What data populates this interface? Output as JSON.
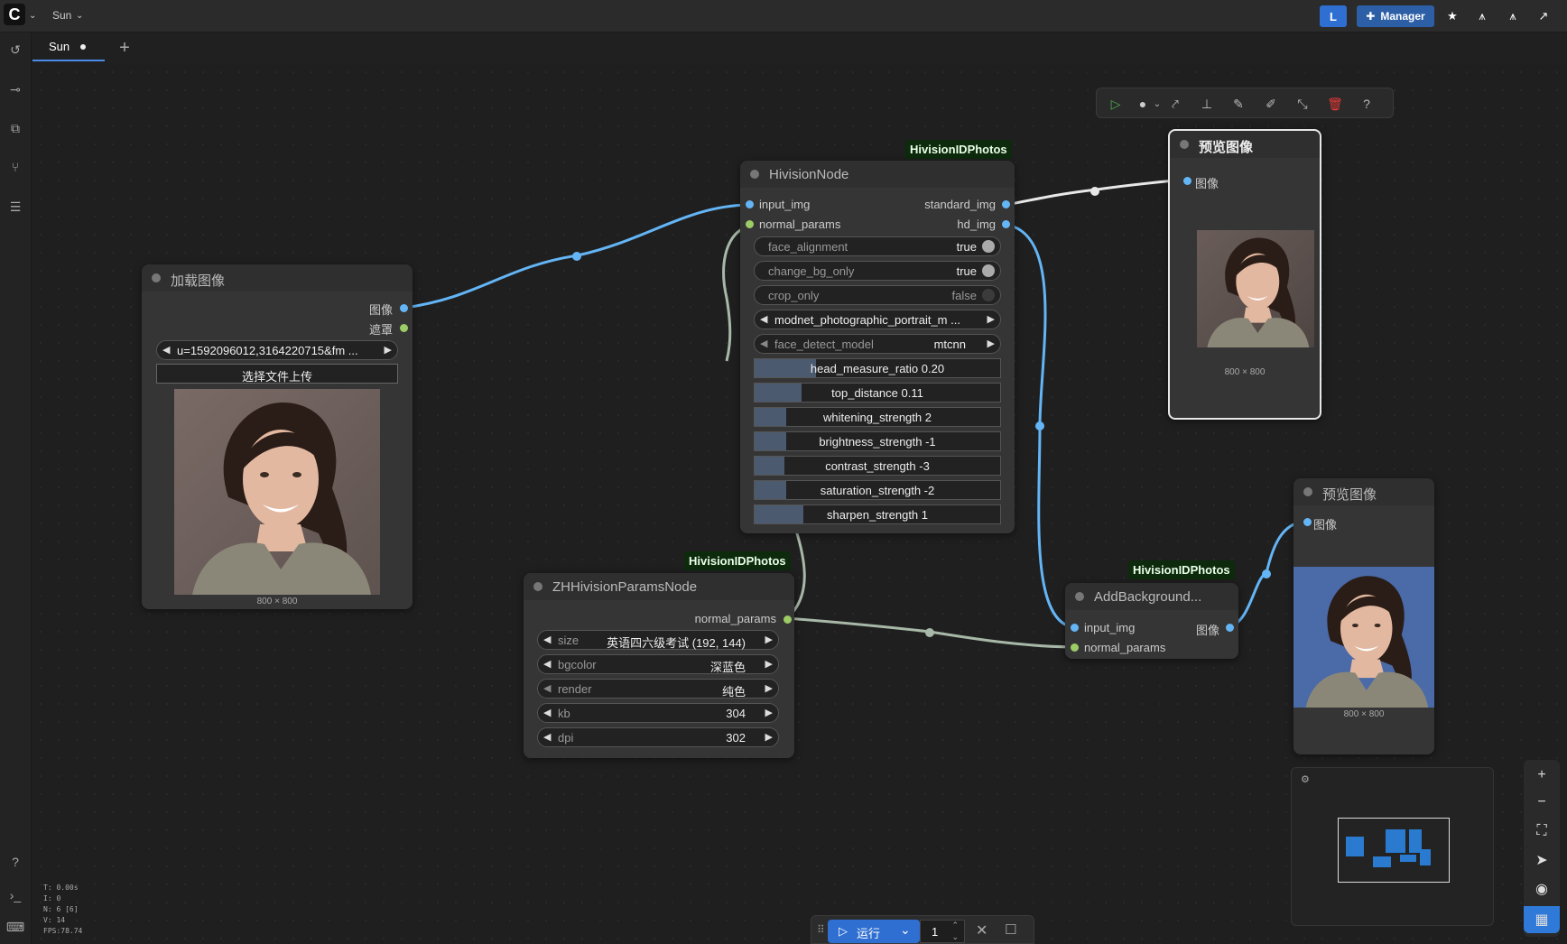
{
  "app": {
    "workflow_name": "Sun",
    "manager_label": "Manager",
    "user_initial": "L",
    "accent": "#4a8ae8"
  },
  "tabs": [
    {
      "label": "Sun",
      "unsaved": true
    }
  ],
  "nodes": {
    "load_image": {
      "title": "加载图像",
      "outputs": [
        "图像",
        "遮罩"
      ],
      "file_value": "u=1592096012,3164220715&fm ...",
      "upload_label": "选择文件上传",
      "dims": "800 × 800"
    },
    "hivision": {
      "badge": "HivisionIDPhotos",
      "title": "HivisionNode",
      "inputs": [
        "input_img",
        "normal_params"
      ],
      "outputs": [
        "standard_img",
        "hd_img"
      ],
      "toggles": [
        {
          "label": "face_alignment",
          "value": "true",
          "on": true
        },
        {
          "label": "change_bg_only",
          "value": "true",
          "on": true
        },
        {
          "label": "crop_only",
          "value": "false",
          "on": false
        }
      ],
      "combos": [
        {
          "label": "",
          "value": "modnet_photographic_portrait_m ..."
        },
        {
          "label": "face_detect_model",
          "value": "mtcnn"
        }
      ],
      "sliders": [
        {
          "text": "head_measure_ratio  0.20",
          "level": 0.25
        },
        {
          "text": "top_distance  0.11",
          "level": 0.19
        },
        {
          "text": "whitening_strength  2",
          "level": 0.13
        },
        {
          "text": "brightness_strength  -1",
          "level": 0.13
        },
        {
          "text": "contrast_strength  -3",
          "level": 0.12
        },
        {
          "text": "saturation_strength  -2",
          "level": 0.13
        },
        {
          "text": "sharpen_strength  1",
          "level": 0.2
        }
      ]
    },
    "preview1": {
      "title": "预览图像",
      "input": "图像",
      "dims": "800 × 800"
    },
    "params": {
      "badge": "HivisionIDPhotos",
      "title": "ZHHivisionParamsNode",
      "output": "normal_params",
      "fields": [
        {
          "label": "size",
          "value": "英语四六级考试 (192, 144)"
        },
        {
          "label": "bgcolor",
          "value": "深蓝色"
        },
        {
          "label": "render",
          "value": "纯色"
        },
        {
          "label": "kb",
          "value": "304"
        },
        {
          "label": "dpi",
          "value": "302"
        }
      ]
    },
    "addbg": {
      "badge": "HivisionIDPhotos",
      "title": "AddBackground...",
      "inputs": [
        "input_img",
        "normal_params"
      ],
      "output": "图像"
    },
    "preview2": {
      "title": "预览图像",
      "input": "图像",
      "dims": "800 × 800",
      "bg_color": "#4a6aa8"
    }
  },
  "stats": [
    "T: 0.00s",
    "I: 0",
    "N: 6 [6]",
    "V: 14",
    "FPS:78.74"
  ],
  "runbar": {
    "run_label": "运行",
    "count": "1"
  },
  "icons": {
    "toolbar": [
      "play-icon",
      "color-icon",
      "bypass-icon",
      "pin-icon",
      "edit-icon",
      "pencil-icon",
      "collapse-icon",
      "trash-icon",
      "help-icon"
    ],
    "sidebar": [
      "history-icon",
      "node-library-icon",
      "models-icon",
      "workflows-icon",
      "templates-icon",
      "help-icon",
      "terminal-icon",
      "keyboard-icon"
    ]
  }
}
